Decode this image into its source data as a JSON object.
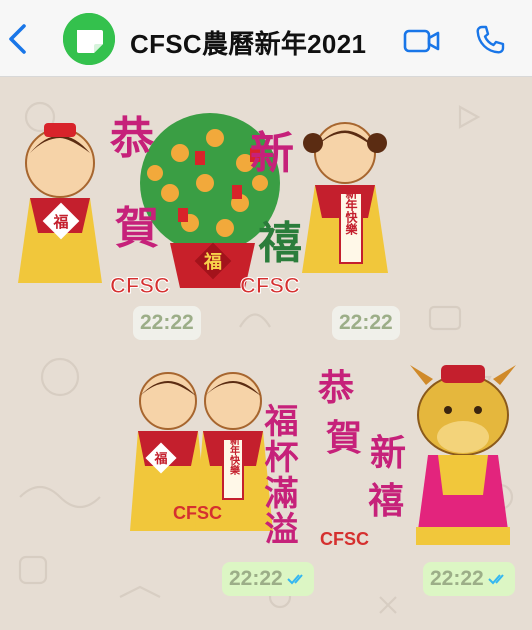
{
  "header": {
    "title": "CFSC農曆新年2021",
    "icons": {
      "back": "chevron-left-icon",
      "avatar": "whatsapp-sticker-avatar",
      "video": "video-call-icon",
      "phone": "phone-icon"
    },
    "accent": "#1976e8"
  },
  "messages": [
    {
      "type": "sticker",
      "direction": "incoming",
      "texts": {
        "line1_a": "恭",
        "line1_b": "賀",
        "line2_a": "新",
        "line2_b": "禧",
        "tree_char": "福",
        "pot_char": "福",
        "tag_char": "福",
        "scroll": "新年快樂",
        "brand_left": "CFSC",
        "brand_right": "CFSC"
      },
      "time": "22:22"
    },
    {
      "type": "sticker",
      "direction": "incoming",
      "time": "22:22"
    },
    {
      "type": "sticker",
      "direction": "outgoing",
      "texts": {
        "col1": "福杯滿溢",
        "brand": "CFSC",
        "tag_char": "福",
        "scroll": "新年快樂"
      },
      "time": "22:22",
      "status": "read"
    },
    {
      "type": "sticker",
      "direction": "outgoing",
      "texts": {
        "c1": "恭",
        "c2": "賀",
        "c3": "新",
        "c4": "禧",
        "brand": "CFSC"
      },
      "time": "22:22",
      "status": "read"
    }
  ],
  "colors": {
    "chat_bg": "#e6ddd3",
    "incoming_time_bg": "#f0f0ea",
    "outgoing_time_bg": "#dcf6c4",
    "time_text": "#9cae88",
    "read_ticks": "#34b7f1"
  }
}
